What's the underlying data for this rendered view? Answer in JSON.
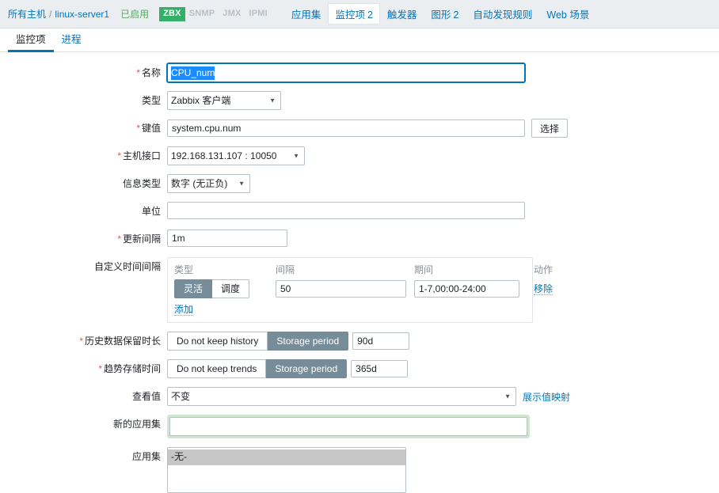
{
  "header": {
    "breadcrumb_all_hosts": "所有主机",
    "breadcrumb_separator": "/",
    "breadcrumb_host": "linux-server1",
    "status": "已启用",
    "interfaces": [
      {
        "label": "ZBX",
        "active": true
      },
      {
        "label": "SNMP",
        "active": false
      },
      {
        "label": "JMX",
        "active": false
      },
      {
        "label": "IPMI",
        "active": false
      }
    ],
    "nav_tabs": [
      {
        "label": "应用集",
        "count": "",
        "selected": false
      },
      {
        "label": "监控项",
        "count": "2",
        "selected": true
      },
      {
        "label": "触发器",
        "count": "",
        "selected": false
      },
      {
        "label": "图形",
        "count": "2",
        "selected": false
      },
      {
        "label": "自动发现规则",
        "count": "",
        "selected": false
      },
      {
        "label": "Web 场景",
        "count": "",
        "selected": false
      }
    ]
  },
  "subtabs": [
    {
      "label": "监控项",
      "active": true
    },
    {
      "label": "进程",
      "active": false
    }
  ],
  "form": {
    "name": {
      "label": "名称",
      "required": true,
      "value": "CPU_num",
      "selected": true,
      "focused": true
    },
    "type": {
      "label": "类型",
      "required": false,
      "value": "Zabbix 客户端"
    },
    "key": {
      "label": "键值",
      "required": true,
      "value": "system.cpu.num",
      "select_button": "选择"
    },
    "host_interface": {
      "label": "主机接口",
      "required": true,
      "value": "192.168.131.107 : 10050"
    },
    "info_type": {
      "label": "信息类型",
      "required": false,
      "value": "数字 (无正负)"
    },
    "units": {
      "label": "单位",
      "required": false,
      "value": "",
      "placeholder": ""
    },
    "update_interval": {
      "label": "更新间隔",
      "required": true,
      "value": "1m"
    },
    "custom_intervals": {
      "label": "自定义时间间隔",
      "required": false,
      "columns": [
        "类型",
        "间隔",
        "期间",
        "动作"
      ],
      "rows": [
        {
          "type_options": [
            "灵活",
            "调度"
          ],
          "type_selected": "灵活",
          "delay": "50",
          "period": "1-7,00:00-24:00",
          "remove_label": "移除"
        }
      ],
      "add_label": "添加"
    },
    "history": {
      "label": "历史数据保留时长",
      "required": true,
      "options": [
        "Do not keep history",
        "Storage period"
      ],
      "selected": "Storage period",
      "value": "90d"
    },
    "trends": {
      "label": "趋势存储时间",
      "required": true,
      "options": [
        "Do not keep trends",
        "Storage period"
      ],
      "selected": "Storage period",
      "value": "365d"
    },
    "value_map": {
      "label": "查看值",
      "required": false,
      "value": "不变",
      "link_label": "展示值映射"
    },
    "new_application": {
      "label": "新的应用集",
      "required": false,
      "value": "",
      "highlighted": true
    },
    "applications": {
      "label": "应用集",
      "required": false,
      "options": [
        {
          "label": "-无-",
          "selected": true
        }
      ]
    }
  },
  "colors": {
    "accent_link": "#0275b8",
    "header_bg": "#ebeef1",
    "badge_active": "#34af67",
    "toggle_on": "#768d99",
    "required_star": "#d45c5c",
    "selection_blue": "#1a8cff",
    "highlight_green": "#cfe7cf",
    "status_green": "#59a869"
  }
}
